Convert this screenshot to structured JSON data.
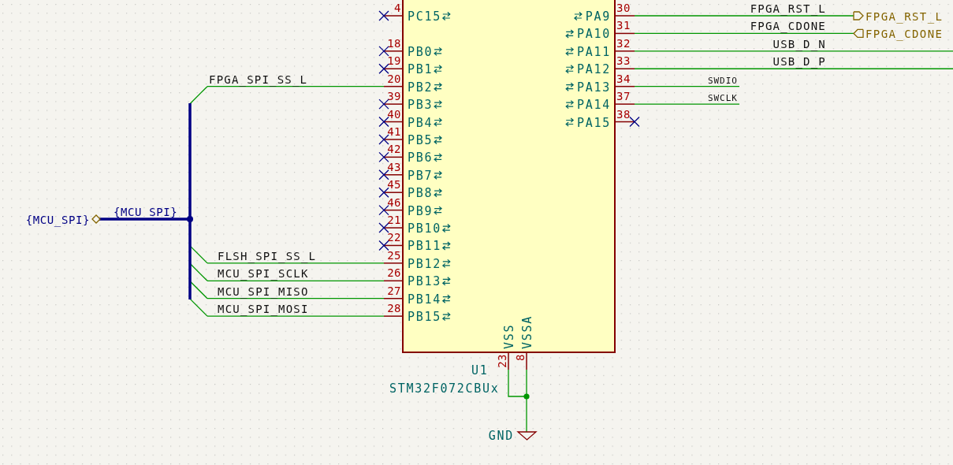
{
  "symbol": {
    "reference": "U1",
    "value": "STM32F072CBUx",
    "left_pins": [
      {
        "number": "4",
        "name": "PC15",
        "no_connect": true
      },
      {
        "number": "18",
        "name": "PB0",
        "no_connect": true
      },
      {
        "number": "19",
        "name": "PB1",
        "no_connect": true
      },
      {
        "number": "20",
        "name": "PB2",
        "no_connect": false,
        "net": "FPGA_SPI_SS_L"
      },
      {
        "number": "39",
        "name": "PB3",
        "no_connect": true
      },
      {
        "number": "40",
        "name": "PB4",
        "no_connect": true
      },
      {
        "number": "41",
        "name": "PB5",
        "no_connect": true
      },
      {
        "number": "42",
        "name": "PB6",
        "no_connect": true
      },
      {
        "number": "43",
        "name": "PB7",
        "no_connect": true
      },
      {
        "number": "45",
        "name": "PB8",
        "no_connect": true
      },
      {
        "number": "46",
        "name": "PB9",
        "no_connect": true
      },
      {
        "number": "21",
        "name": "PB10",
        "no_connect": true
      },
      {
        "number": "22",
        "name": "PB11",
        "no_connect": true
      },
      {
        "number": "25",
        "name": "PB12",
        "no_connect": false,
        "net": "FLSH_SPI_SS_L"
      },
      {
        "number": "26",
        "name": "PB13",
        "no_connect": false,
        "net": "MCU_SPI_SCLK"
      },
      {
        "number": "27",
        "name": "PB14",
        "no_connect": false,
        "net": "MCU_SPI_MISO"
      },
      {
        "number": "28",
        "name": "PB15",
        "no_connect": false,
        "net": "MCU_SPI_MOSI"
      }
    ],
    "right_pins": [
      {
        "number": "30",
        "name": "PA9",
        "no_connect": false,
        "net": {
          "name": "FPGA_RST_L",
          "kind": "output",
          "global_label": "FPGA_RST_L"
        }
      },
      {
        "number": "31",
        "name": "PA10",
        "no_connect": false,
        "net": {
          "name": "FPGA_CDONE",
          "kind": "input",
          "global_label": "FPGA_CDONE"
        }
      },
      {
        "number": "32",
        "name": "PA11",
        "no_connect": false,
        "net": {
          "name": "USB_D_N",
          "kind": "through"
        }
      },
      {
        "number": "33",
        "name": "PA12",
        "no_connect": false,
        "net": {
          "name": "USB_D_P",
          "kind": "through"
        }
      },
      {
        "number": "34",
        "name": "PA13",
        "no_connect": false,
        "net": {
          "name": "SWDIO",
          "kind": "stub"
        }
      },
      {
        "number": "37",
        "name": "PA14",
        "no_connect": false,
        "net": {
          "name": "SWCLK",
          "kind": "stub"
        }
      },
      {
        "number": "38",
        "name": "PA15",
        "no_connect": true
      }
    ],
    "bottom_pins": [
      {
        "number": "23",
        "name": "VSS"
      },
      {
        "number": "8",
        "name": "VSSA"
      }
    ]
  },
  "bus": {
    "label": "{MCU_SPI}",
    "hierarchical_label": "{MCU_SPI}"
  },
  "power": {
    "label": "GND"
  }
}
